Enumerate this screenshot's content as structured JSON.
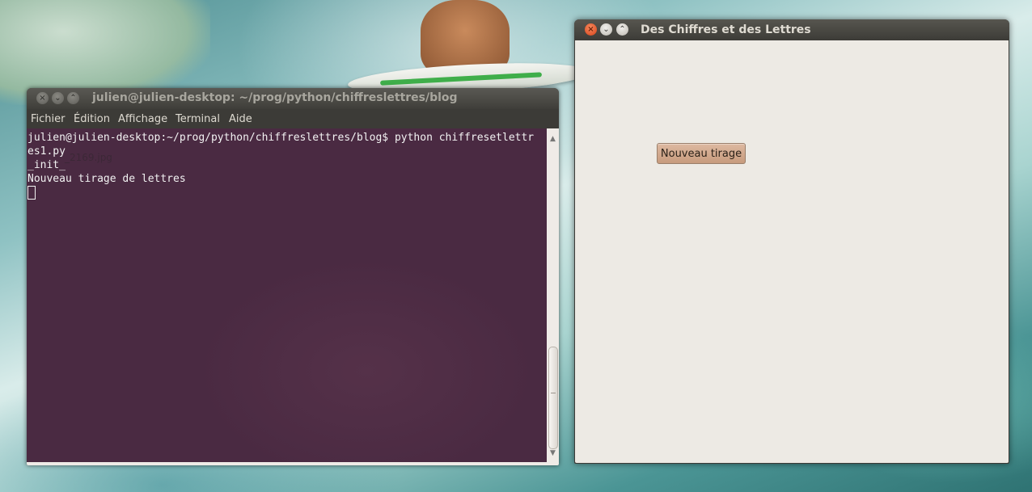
{
  "desktop": {
    "file_label": "_2169.jpg"
  },
  "terminal": {
    "title": "julien@julien-desktop: ~/prog/python/chiffreslettres/blog",
    "buttons": {
      "close": "×",
      "minimize": "⌄",
      "maximize": "⌃"
    },
    "menu": [
      "Fichier",
      "Édition",
      "Affichage",
      "Terminal",
      "Aide"
    ],
    "lines": [
      "julien@julien-desktop:~/prog/python/chiffreslettres/blog$ python chiffresetlettr",
      "es1.py",
      "_init_",
      "Nouveau tirage de lettres"
    ],
    "scroll_up": "▲",
    "scroll_down": "▼"
  },
  "app": {
    "title": "Des Chiffres et des Lettres",
    "buttons": {
      "close": "×",
      "minimize": "⌄",
      "maximize": "⌃"
    },
    "nouveau_tirage_label": "Nouveau tirage"
  },
  "colors": {
    "terminal_background": "#4a2a42",
    "app_background": "#edeae4",
    "titlebar": "#3c3b37",
    "close_button": "#e0531f",
    "button_face": "#d2a98d"
  }
}
